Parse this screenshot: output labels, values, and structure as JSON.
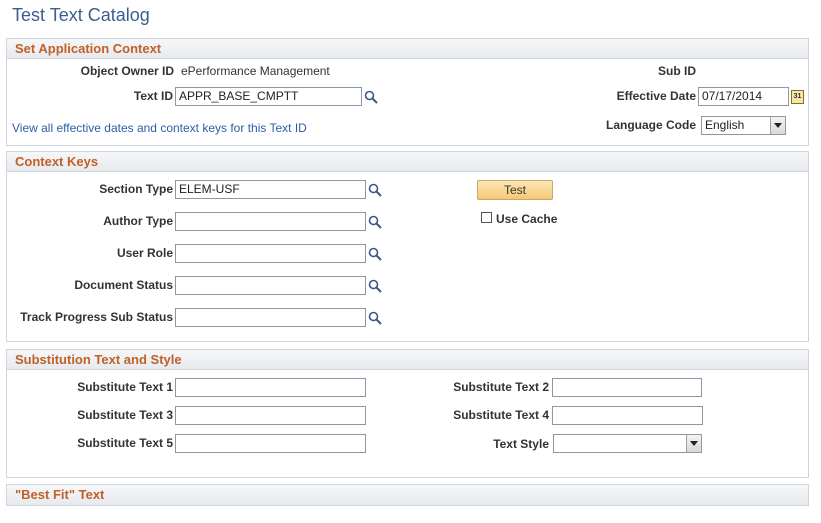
{
  "page": {
    "title": "Test Text Catalog"
  },
  "app_context": {
    "header": "Set Application Context",
    "object_owner_label": "Object Owner ID",
    "object_owner_value": "ePerformance Management",
    "sub_id_label": "Sub ID",
    "text_id_label": "Text ID",
    "text_id_value": "APPR_BASE_CMPTT",
    "effective_date_label": "Effective Date",
    "effective_date_value": "07/17/2014",
    "view_link": "View all effective dates and context keys for this Text ID",
    "language_label": "Language Code",
    "language_value": "English"
  },
  "context_keys": {
    "header": "Context Keys",
    "section_type_label": "Section Type",
    "section_type_value": "ELEM-USF",
    "author_type_label": "Author Type",
    "user_role_label": "User Role",
    "document_status_label": "Document Status",
    "track_progress_label": "Track Progress Sub Status",
    "test_button": "Test",
    "use_cache_label": "Use Cache"
  },
  "substitution": {
    "header": "Substitution Text and Style",
    "sub1_label": "Substitute Text 1",
    "sub2_label": "Substitute Text 2",
    "sub3_label": "Substitute Text 3",
    "sub4_label": "Substitute Text 4",
    "sub5_label": "Substitute Text 5",
    "text_style_label": "Text Style"
  },
  "best_fit": {
    "header": "\"Best Fit\" Text"
  },
  "icons": {
    "lookup": "magnifier-icon",
    "calendar": "calendar-icon"
  },
  "colors": {
    "section_header": "#c0602a",
    "title": "#3a5f8c",
    "link": "#2b5fa7"
  }
}
